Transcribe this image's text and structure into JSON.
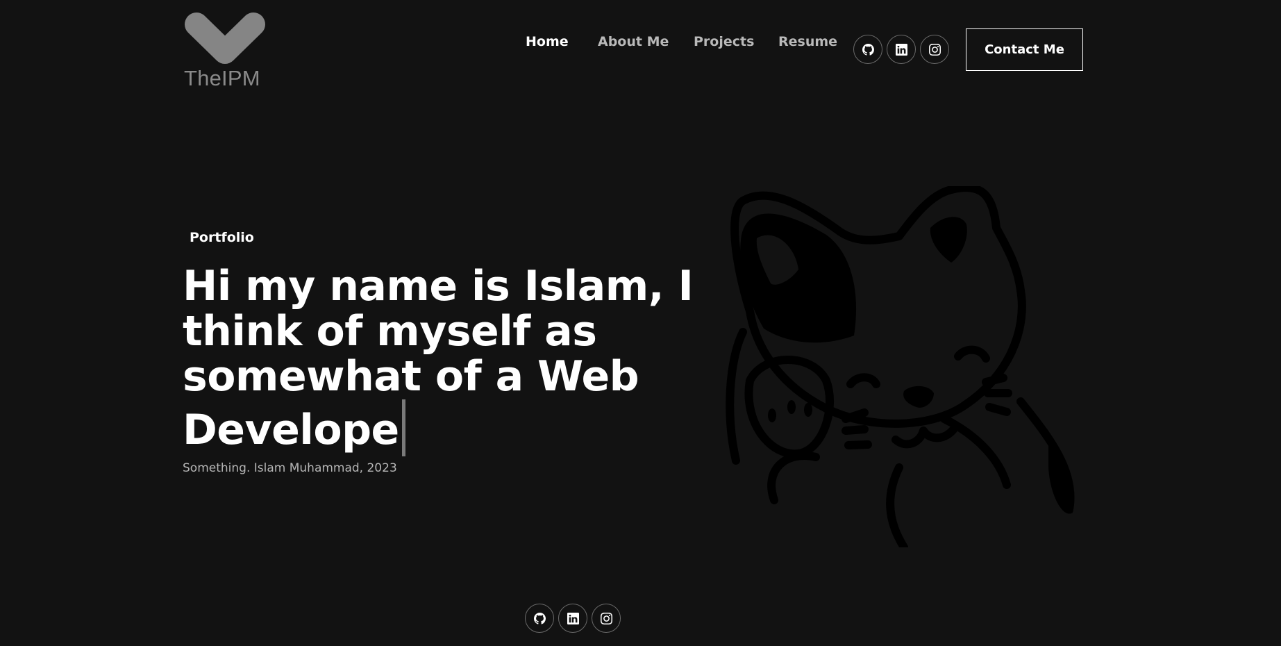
{
  "logo": {
    "text": "TheIPM"
  },
  "nav": {
    "items": [
      {
        "label": "Home",
        "active": true
      },
      {
        "label": "About Me",
        "active": false
      },
      {
        "label": "Projects",
        "active": false
      },
      {
        "label": "Resume",
        "active": false
      }
    ],
    "social": [
      "github-icon",
      "linkedin-icon",
      "instagram-icon"
    ],
    "contact_label": "Contact Me"
  },
  "hero": {
    "tagline": "Portfolio",
    "headline": "Hi my name is Islam, I think of myself as somewhat of a Web Develope",
    "credit": "Something. Islam Muhammad, 2023"
  },
  "footer": {
    "social": [
      "github-icon",
      "linkedin-icon",
      "instagram-icon"
    ]
  },
  "colors": {
    "background": "#121212",
    "text": "#ffffff",
    "muted": "#b9b9b9",
    "logo": "#8a8a8a"
  }
}
